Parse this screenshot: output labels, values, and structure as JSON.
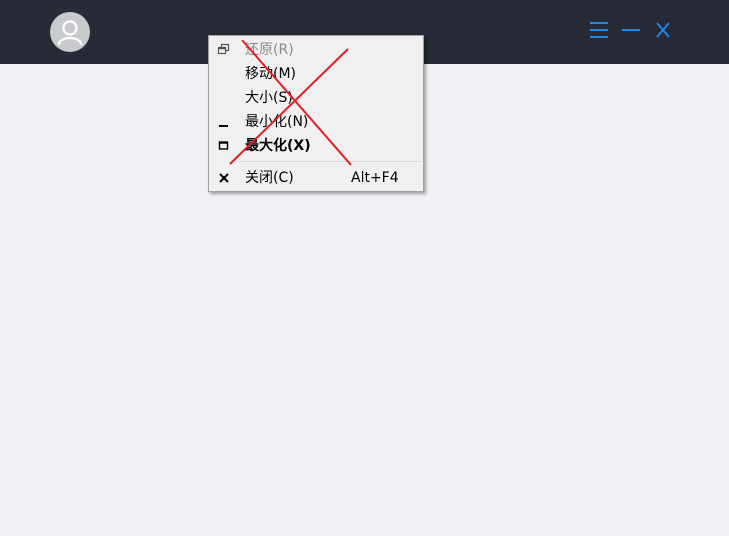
{
  "window": {
    "icons": {
      "avatar": "user-avatar-icon",
      "menu": "hamburger-menu-icon",
      "minimize": "minimize-icon",
      "close": "close-icon"
    },
    "colors": {
      "titlebar": "#262b36",
      "content_bg": "#f0f1f5",
      "accent": "#1e88e5",
      "annotation": "#e02020"
    }
  },
  "system_menu": {
    "items": [
      {
        "label": "还原(R)",
        "icon": "restore-icon",
        "enabled": false
      },
      {
        "label": "移动(M)",
        "icon": "",
        "enabled": true
      },
      {
        "label": "大小(S)",
        "icon": "",
        "enabled": true
      },
      {
        "label": "最小化(N)",
        "icon": "minimize-icon",
        "enabled": true
      },
      {
        "label": "最大化(X)",
        "icon": "maximize-icon",
        "enabled": true,
        "default": true
      },
      {
        "label": "关闭(C)",
        "shortcut": "Alt+F4",
        "icon": "close-icon",
        "enabled": true
      }
    ]
  }
}
